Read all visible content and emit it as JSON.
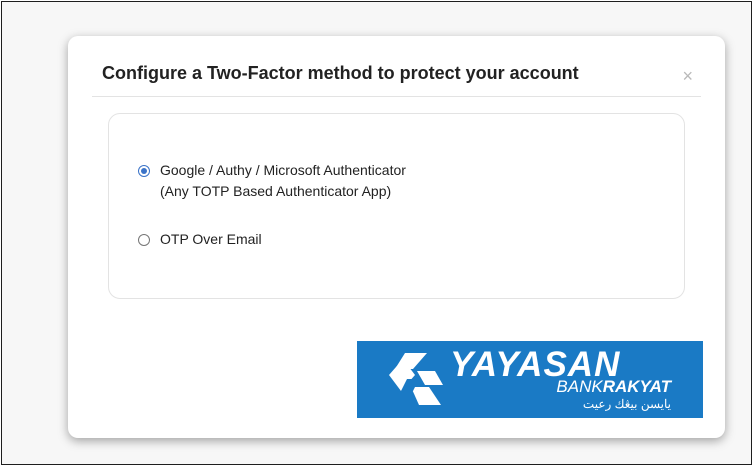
{
  "modal": {
    "title": "Configure a Two-Factor method to protect your account",
    "close_label": "×"
  },
  "options": [
    {
      "label": "Google / Authy / Microsoft Authenticator",
      "sublabel": "(Any TOTP Based Authenticator App)",
      "selected": true
    },
    {
      "label": "OTP Over Email",
      "selected": false
    }
  ],
  "logo": {
    "main_text": "YAYASAN",
    "sub_text_regular": "BANK",
    "sub_text_bold": "RAKYAT",
    "jawi_text": "يايسن بيڠك رعيت",
    "background_color": "#1a7ac5"
  },
  "colors": {
    "radio_accent": "#3b73c8"
  }
}
